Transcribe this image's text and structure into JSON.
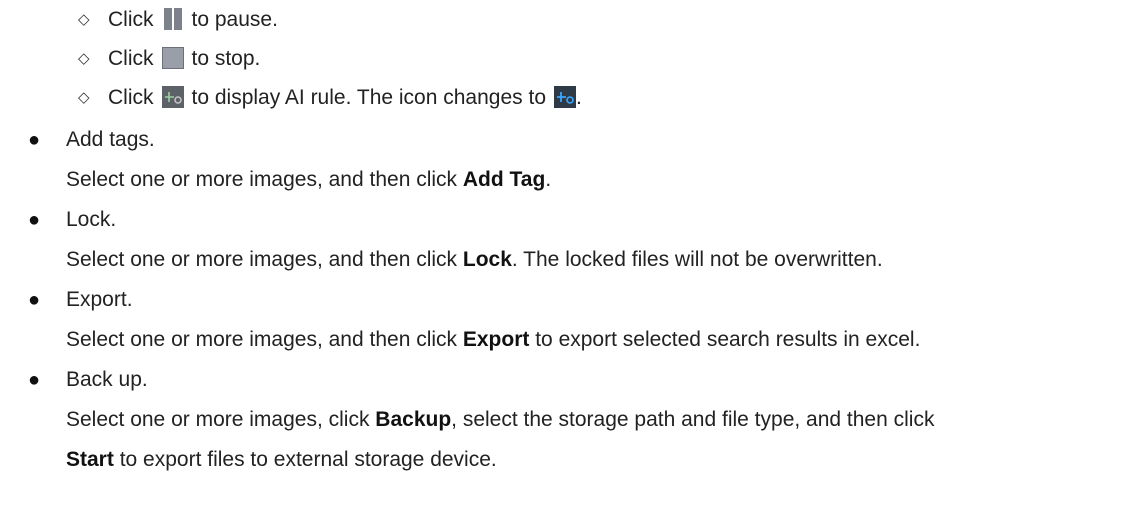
{
  "playback_controls": [
    {
      "pre": "Click",
      "post": "to pause."
    },
    {
      "pre": "Click",
      "post": "to stop."
    },
    {
      "pre": "Click",
      "mid": "to display AI rule. The icon changes to",
      "post": "."
    }
  ],
  "icons": {
    "pause": "pause-icon",
    "stop": "stop-icon",
    "ai_rule": "ai-rule-icon",
    "ai_rule_active": "ai-rule-active-icon"
  },
  "items": [
    {
      "title": "Add tags.",
      "pre": "Select one or more images, and then click ",
      "bold": "Add Tag",
      "post": "."
    },
    {
      "title": "Lock.",
      "pre": "Select one or more images, and then click ",
      "bold": "Lock",
      "post": ". The locked files will not be overwritten."
    },
    {
      "title": "Export.",
      "pre": "Select one or more images, and then click ",
      "bold": "Export",
      "post": " to export selected search results in excel."
    },
    {
      "title": "Back up.",
      "pre": "Select one or more images, click ",
      "bold": "Backup",
      "post": ", select the storage path and file type, and then click",
      "line2_bold": "Start",
      "line2_post": " to export files to external storage device."
    }
  ]
}
